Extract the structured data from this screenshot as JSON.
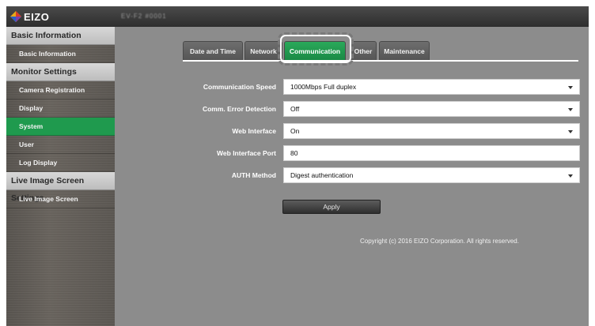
{
  "brand": {
    "logo_text": "EIZO",
    "device_name": "EV-F2 #0001"
  },
  "sidebar": {
    "sections": [
      {
        "title": "Basic Information",
        "items": [
          "Basic Information"
        ]
      },
      {
        "title": "Monitor Settings",
        "items": [
          "Camera Registration",
          "Display",
          "System",
          "User",
          "Log Display"
        ]
      },
      {
        "title": "Live Image Screen Settings",
        "items": [
          "Live Image Screen"
        ]
      }
    ],
    "active_item": "System"
  },
  "tabs": [
    {
      "label": "Date and Time"
    },
    {
      "label": "Network"
    },
    {
      "label": "Communication",
      "active": true
    },
    {
      "label": "Other"
    },
    {
      "label": "Maintenance"
    }
  ],
  "form": {
    "comm_speed": {
      "label": "Communication Speed",
      "value": "1000Mbps Full duplex"
    },
    "comm_error": {
      "label": "Comm. Error Detection",
      "value": "Off"
    },
    "web_interface": {
      "label": "Web Interface",
      "value": "On"
    },
    "web_port": {
      "label": "Web Interface Port",
      "value": "80"
    },
    "auth_method": {
      "label": "AUTH Method",
      "value": "Digest authentication"
    }
  },
  "apply_label": "Apply",
  "copyright": "Copyright (c) 2016 EIZO Corporation. All rights reserved.",
  "colors": {
    "accent": "#1f9a4e",
    "content_bg": "#8c8c8c",
    "topbar_bg": "#333333"
  }
}
